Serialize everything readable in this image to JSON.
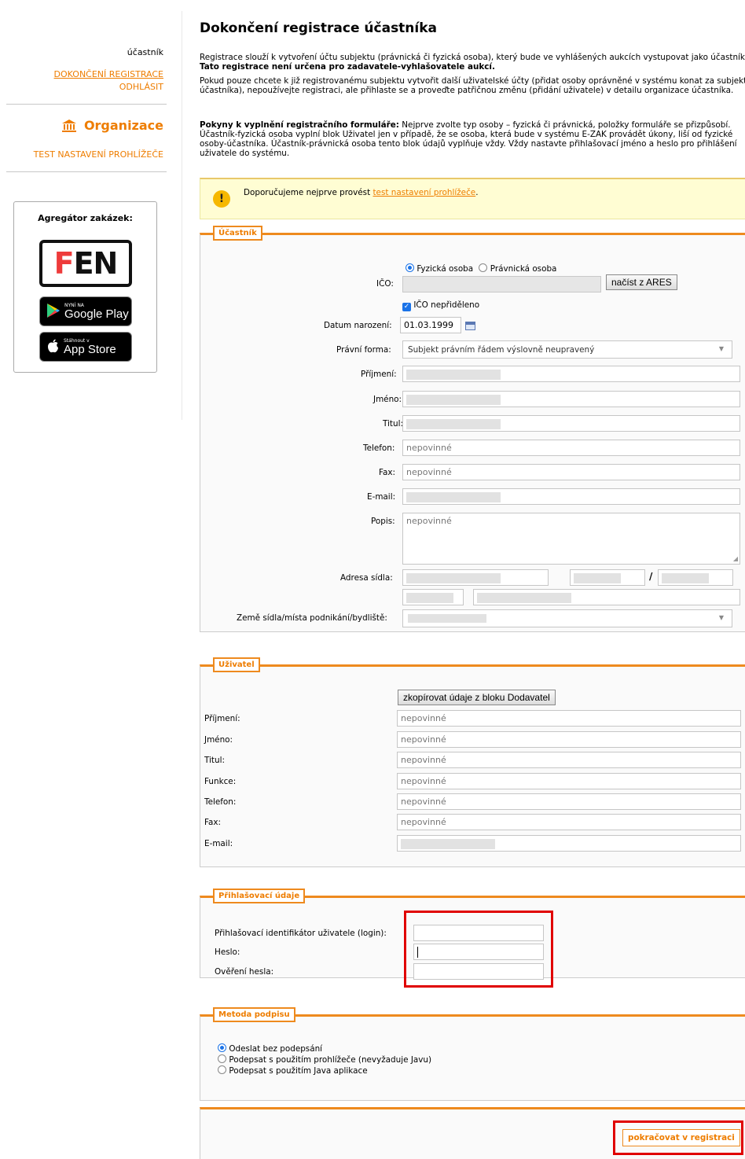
{
  "sidebar": {
    "user_label": "účastník",
    "complete_registration_link": "DOKONČENÍ REGISTRACE",
    "logout_link": "ODHLÁSIT",
    "organization_label": "Organizace",
    "browser_test_link": "TEST NASTAVENÍ PROHLÍŽEČE",
    "aggregator": {
      "title": "Agregátor zakázek:",
      "fen_logo_f": "F",
      "fen_logo_en": "EN",
      "google_play_small": "NYNÍ NA",
      "google_play_big": "Google Play",
      "app_store_small": "Stáhnout v",
      "app_store_big": "App Store"
    }
  },
  "main": {
    "title": "Dokončení registrace účastníka",
    "intro_p1_normal": "Registrace slouží k vytvoření účtu subjektu (právnická či fyzická osoba), který bude ve vyhlášených aukcích vystupovat jako účastník.",
    "intro_p1_bold": "Tato registrace není určena pro zadavatele-vyhlašovatele aukcí.",
    "intro_p2": "Pokud pouze chcete k již registrovanému subjektu vytvořit další uživatelské účty (přidat osoby oprávněné v systému konat za subjekt účastníka), nepoužívejte registraci, ale přihlaste se a proveďte patřičnou změnu (přidání uživatele) v detailu organizace účastníka.",
    "intro_p3_bold": "Pokyny k vyplnění registračního formuláře:",
    "intro_p3": "Nejprve zvolte typ osoby – fyzická či právnická, položky formuláře se přizpůsobí. Účastník-fyzická osoba vyplní blok Uživatel jen v případě, že se osoba, která bude v systému E-ZAK provádět úkony, liší od fyzické osoby-účastníka. Účastník-právnická osoba tento blok údajů vyplňuje vždy. Vždy nastavte přihlašovací jméno a heslo pro přihlášení uživatele do systému.",
    "notice_text": "Doporučujeme nejprve provést",
    "notice_link": "test nastavení prohlížeče",
    "notice_end": "."
  },
  "participant": {
    "legend": "Účastník",
    "person_type_physical": "Fyzická osoba",
    "person_type_legal": "Právnická osoba",
    "ico_label": "IČO:",
    "load_ares_button": "načíst z ARES",
    "ico_unassigned": "IČO nepřiděleno",
    "birth_date_label": "Datum narození:",
    "birth_date_value": "01.03.1999",
    "legal_form_label": "Právní forma:",
    "legal_form_value": "Subjekt právním řádem výslovně neupravený",
    "surname_label": "Příjmení:",
    "name_label": "Jméno:",
    "title_label": "Titul:",
    "phone_label": "Telefon:",
    "phone_placeholder": "nepovinné",
    "fax_label": "Fax:",
    "fax_placeholder": "nepovinné",
    "email_label": "E-mail:",
    "description_label": "Popis:",
    "description_placeholder": "nepovinné",
    "address_label": "Adresa sídla:",
    "address_slash": "/",
    "country_label": "Země sídla/místa podnikání/bydliště:"
  },
  "user": {
    "legend": "Uživatel",
    "copy_button": "zkopírovat údaje z bloku Dodavatel",
    "surname_label": "Příjmení:",
    "name_label": "Jméno:",
    "title_label": "Titul:",
    "function_label": "Funkce:",
    "phone_label": "Telefon:",
    "fax_label": "Fax:",
    "email_label": "E-mail:",
    "optional": "nepovinné"
  },
  "login": {
    "legend": "Přihlašovací údaje",
    "login_label": "Přihlašovací identifikátor uživatele (login):",
    "password_label": "Heslo:",
    "password_confirm_label": "Ověření hesla:"
  },
  "signature": {
    "legend": "Metoda podpisu",
    "option_1": "Odeslat bez podepsání",
    "option_2": "Podepsat s použitím prohlížeče (nevyžaduje Javu)",
    "option_3": "Podepsat s použitím Java aplikace"
  },
  "continue_button": "pokračovat v registraci",
  "colors": {
    "accent": "#ee7d00",
    "highlight_box": "#e00000",
    "notice_bg": "#fffdd3"
  }
}
